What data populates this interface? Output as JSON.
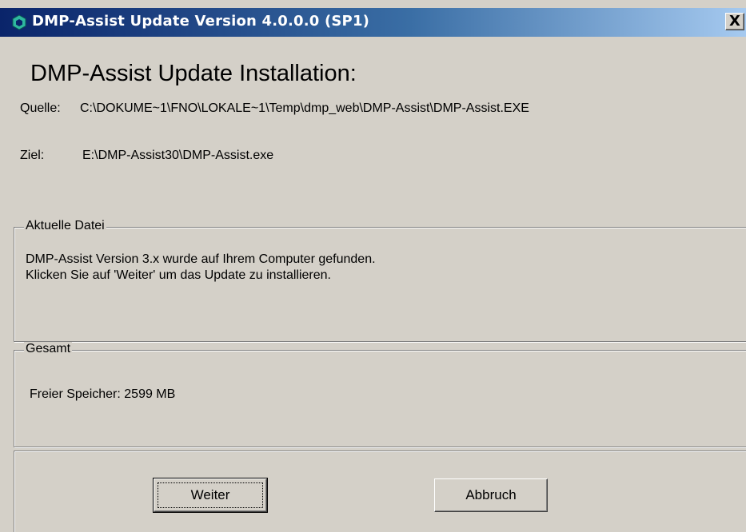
{
  "window": {
    "title": "DMP-Assist Update Version 4.0.0.0 (SP1)",
    "close_symbol": "X"
  },
  "heading": "DMP-Assist Update Installation:",
  "source": {
    "label": "Quelle:",
    "value": "C:\\DOKUME~1\\FNO\\LOKALE~1\\Temp\\dmp_web\\DMP-Assist\\DMP-Assist.EXE"
  },
  "target": {
    "label": "Ziel:",
    "value": "E:\\DMP-Assist30\\DMP-Assist.exe"
  },
  "current_file": {
    "legend": "Aktuelle Datei",
    "line1": "DMP-Assist Version 3.x wurde auf Ihrem Computer gefunden.",
    "line2": "Klicken Sie auf 'Weiter' um das Update zu installieren."
  },
  "total": {
    "legend": "Gesamt",
    "free_space": "Freier Speicher: 2599 MB"
  },
  "buttons": {
    "next": "Weiter",
    "cancel": "Abbruch"
  },
  "icons": {
    "app": "hexagon-app-icon",
    "close": "close-icon"
  },
  "colors": {
    "titlebar_start": "#0a246a",
    "titlebar_end": "#a6caf0",
    "face": "#d4d0c8",
    "app_icon": "#2fb8a0"
  }
}
